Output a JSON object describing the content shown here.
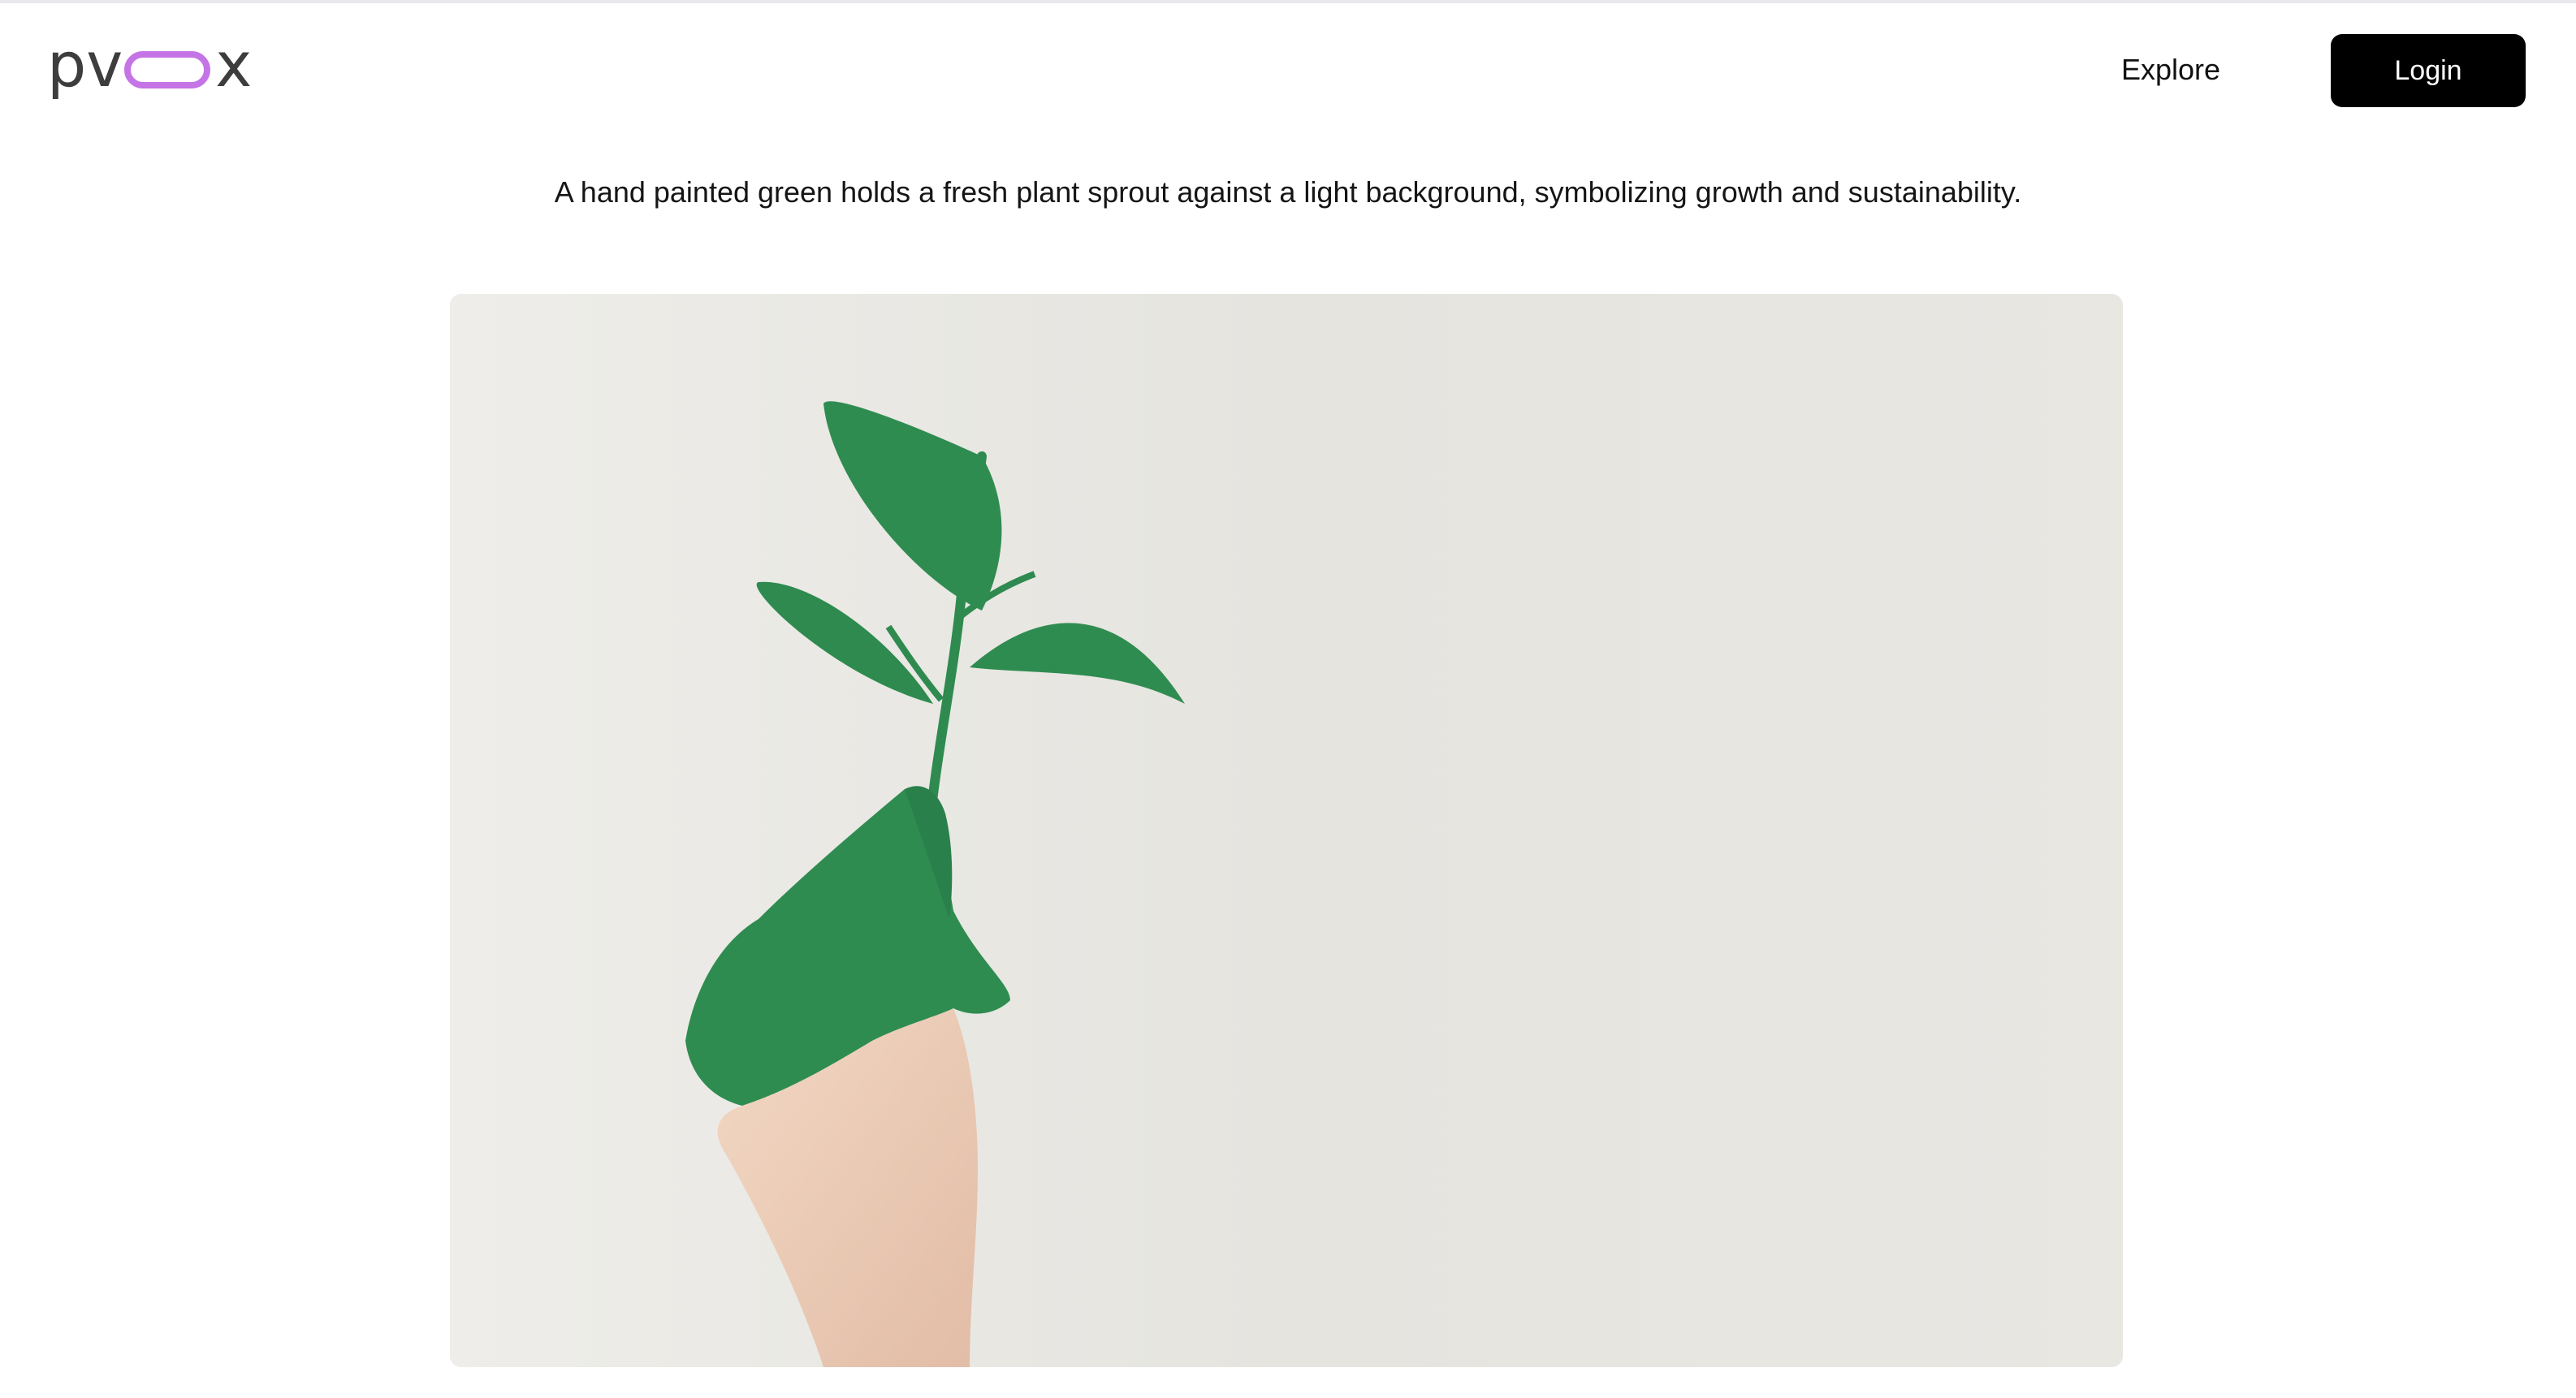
{
  "brand": {
    "prefix": "pv",
    "suffix": "x",
    "accent_color": "#c574e6",
    "text_color": "#3d3d3d"
  },
  "nav": {
    "explore_label": "Explore",
    "login_label": "Login"
  },
  "main": {
    "caption": "A hand painted green holds a fresh plant sprout against a light background, symbolizing growth and sustainability."
  },
  "colors": {
    "login_bg": "#000000",
    "leaf_green": "#2f8c50",
    "photo_bg": "#e6e5e0"
  },
  "icons": {
    "logo_pill": "rounded-rectangle-outline"
  }
}
